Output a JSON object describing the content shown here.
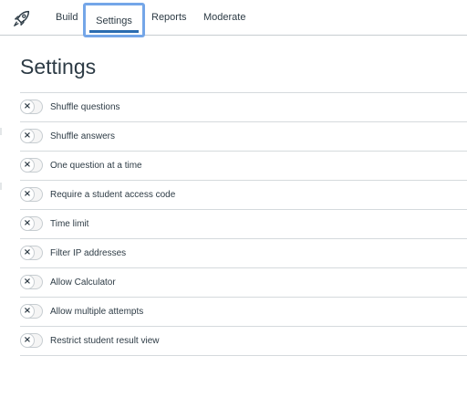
{
  "nav": {
    "logo_icon": "rocket-icon",
    "tabs": [
      {
        "label": "Build",
        "active": false
      },
      {
        "label": "Settings",
        "active": true
      },
      {
        "label": "Reports",
        "active": false
      },
      {
        "label": "Moderate",
        "active": false
      }
    ]
  },
  "page": {
    "title": "Settings"
  },
  "settings": [
    {
      "label": "Shuffle questions",
      "enabled": false
    },
    {
      "label": "Shuffle answers",
      "enabled": false
    },
    {
      "label": "One question at a time",
      "enabled": false
    },
    {
      "label": "Require a student access code",
      "enabled": false
    },
    {
      "label": "Time limit",
      "enabled": false
    },
    {
      "label": "Filter IP addresses",
      "enabled": false
    },
    {
      "label": "Allow Calculator",
      "enabled": false
    },
    {
      "label": "Allow multiple attempts",
      "enabled": false
    },
    {
      "label": "Restrict student result view",
      "enabled": false
    }
  ],
  "toggle_off_glyph": "×",
  "colors": {
    "text": "#2d3b45",
    "active_tab_underline": "#2b6cb0",
    "focus_outline": "#74a6e8",
    "divider": "#d5dadd"
  }
}
